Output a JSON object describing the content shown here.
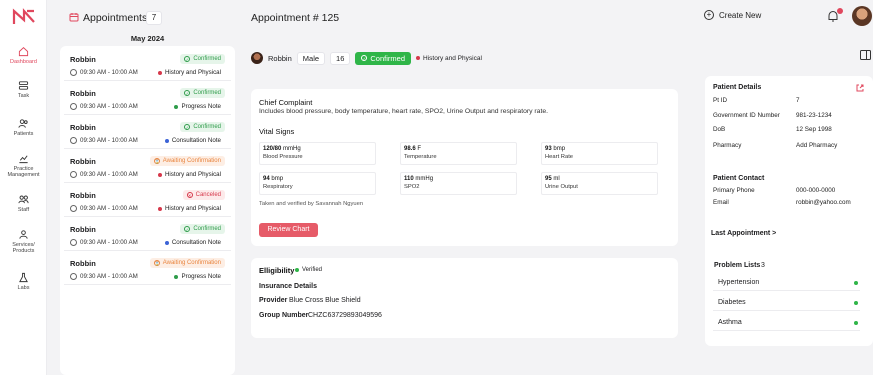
{
  "nav": {
    "items": [
      {
        "label": "Dashboard",
        "icon": "home-icon"
      },
      {
        "label": "Task",
        "icon": "layers-icon"
      },
      {
        "label": "Patients",
        "icon": "users-icon"
      },
      {
        "label": "Practice Management",
        "icon": "chart-icon"
      },
      {
        "label": "Staff",
        "icon": "staff-icon"
      },
      {
        "label": "Services/ Products",
        "icon": "services-icon"
      },
      {
        "label": "Labs",
        "icon": "flask-icon"
      }
    ]
  },
  "header": {
    "appointments_title": "Appointments",
    "appointments_count": "7",
    "appointment_heading": "Appointment # 125",
    "create_new": "Create New"
  },
  "list": {
    "month": "May 2024",
    "items": [
      {
        "name": "Robbin",
        "time": "09:30 AM - 10:00 AM",
        "status": "Confirmed",
        "status_kind": "confirmed",
        "type": "History and Physical",
        "type_color": "#d6384b"
      },
      {
        "name": "Robbin",
        "time": "09:30 AM - 10:00 AM",
        "status": "Confirmed",
        "status_kind": "confirmed",
        "type": "Progress Note",
        "type_color": "#2e9c4a"
      },
      {
        "name": "Robbin",
        "time": "09:30 AM - 10:00 AM",
        "status": "Confirmed",
        "status_kind": "confirmed",
        "type": "Consultation Note",
        "type_color": "#3c63d6"
      },
      {
        "name": "Robbin",
        "time": "09:30 AM - 10:00 AM",
        "status": "Awaiting Confirmation",
        "status_kind": "awaiting",
        "type": "History and Physical",
        "type_color": "#d6384b"
      },
      {
        "name": "Robbin",
        "time": "09:30 AM - 10:00 AM",
        "status": "Canceled",
        "status_kind": "canceled",
        "type": "History and Physical",
        "type_color": "#d6384b"
      },
      {
        "name": "Robbin",
        "time": "09:30 AM - 10:00 AM",
        "status": "Confirmed",
        "status_kind": "confirmed",
        "type": "Consultation Note",
        "type_color": "#3c63d6"
      },
      {
        "name": "Robbin",
        "time": "09:30 AM - 10:00 AM",
        "status": "Awaiting Confirmation",
        "status_kind": "awaiting",
        "type": "Progress Note",
        "type_color": "#2e9c4a"
      }
    ]
  },
  "patient_bar": {
    "name": "Robbin",
    "gender": "Male",
    "age": "16",
    "status": "Confirmed",
    "type": "History and Physical"
  },
  "complaint": {
    "title": "Chief Complaint",
    "text": "Includes blood pressure, body temperature, heart rate, SPO2, Urine Output and respiratory rate.",
    "vitals_title": "Vital Signs",
    "vitals": [
      {
        "value": "120/80",
        "unit": "mmHg",
        "label": "Blood Pressure"
      },
      {
        "value": "98.6",
        "unit": "F",
        "label": "Temperature"
      },
      {
        "value": "93",
        "unit": "bmp",
        "label": "Heart Rate"
      },
      {
        "value": "94",
        "unit": "bmp",
        "label": "Respiratory"
      },
      {
        "value": "110",
        "unit": "mmHg",
        "label": "SPO2"
      },
      {
        "value": "95",
        "unit": "ml",
        "label": "Urine Output"
      }
    ],
    "verified_by": "Taken and verified by Savannah Ngyuen",
    "review_button": "Review Chart"
  },
  "eligibility": {
    "title": "Elligibility",
    "status": "Verified",
    "insurance_title": "Insurance Details",
    "provider_label": "Provider",
    "provider_value": "Blue Cross Blue Shield",
    "group_label": "Group Number",
    "group_value": "CHZC63729893049596"
  },
  "patient_details": {
    "title": "Patient Details",
    "rows": [
      {
        "label": "Pt ID",
        "value": "7"
      },
      {
        "label": "Government ID Number",
        "value": "981-23-1234"
      },
      {
        "label": "DoB",
        "value": "12 Sep 1998"
      },
      {
        "label": "Pharmacy",
        "value": "Add Pharmacy"
      }
    ],
    "contact_title": "Patient Contact",
    "contact_rows": [
      {
        "label": "Primary Phone",
        "value": "000-000-0000"
      },
      {
        "label": "Email",
        "value": "robbin@yahoo.com"
      }
    ],
    "last_appointment": "Last Appointment >",
    "problems_title": "Problem Lists",
    "problems_count": "3",
    "problems": [
      "Hypertension",
      "Diabetes",
      "Asthma"
    ]
  },
  "colors": {
    "accent": "#e0475d",
    "confirmed": "#2fb548",
    "awaiting": "#e9853f",
    "canceled": "#d6384b"
  }
}
